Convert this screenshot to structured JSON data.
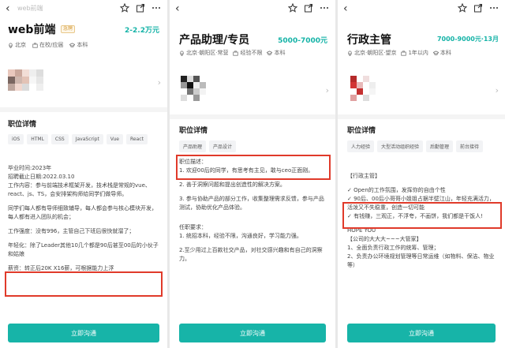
{
  "screens": [
    {
      "breadcrumb": "web前端",
      "title": "web前端",
      "badge": "急聘",
      "salary": "2-2.2万元",
      "meta": [
        "北京",
        "在校/应届",
        "本科"
      ],
      "section_title": "职位详情",
      "tags": [
        "iOS",
        "HTML",
        "CSS",
        "JavaScript",
        "Vue",
        "React"
      ],
      "desc": [
        "毕业时间:2023年",
        "招聘截止日期:2022.03.10",
        "工作内容：参与前端技术框架开发，技术栈是常规的vue、react、js、TS，会安排架构师给同学们做导师。",
        "",
        "同学们每人都有导师细致辅导，每人都会参与核心模块开发，每人都有进入团队的机会；",
        "",
        "工作强度：没有996，主管自己下班后很快就溜了；",
        "",
        "年轻化：除了Leader其他10几个都是90后甚至00后的小伙子和姑娘",
        "",
        "薪资：转正后20K X16薪，可根据能力上浮"
      ],
      "apply_label": "立即沟通"
    },
    {
      "title": "产品助理/专员",
      "salary": "5000-7000元",
      "meta": [
        "北京·朝阳区·常营",
        "经验不限",
        "本科"
      ],
      "section_title": "职位详情",
      "tags": [
        "产品助理",
        "产品设计"
      ],
      "desc": [
        "职位描述：",
        "1. 欢迎00后的同学，有思考有主见，敢与ceo正面刚。",
        "",
        "2. 善于洞察问题和提出创造性的解决方案。",
        "",
        "3. 参与协助产品的部分工作，收集整理需求反馈，参与产品测试，协助优化产品体验。",
        "",
        "",
        "任职要求：",
        "1. 统招本科，经验不限，沟通良好，学习能力强。",
        "",
        "2.至少用过上百款社交产品，对社交感兴趣和有自己的洞察力。"
      ],
      "apply_label": "立即沟通"
    },
    {
      "title": "行政主管",
      "salary": "7000-9000元·13月",
      "meta": [
        "北京·朝阳区·望京",
        "1年以内",
        "本科"
      ],
      "section_title": "职位详情",
      "tags": [
        "人力经验",
        "大型活动组织经验",
        "后勤管理",
        "前台接待"
      ],
      "desc": [
        "【行政主管】",
        "",
        "✓ Open的工作氛围，发挥你的自由个性",
        "✓ 90后、00后小哥哥小姐姐占据半壁江山，年轻充满活力，活泼又不失稳重，创造一切可能",
        "✓ 有钱赚，三观正，不浮夸，不画饼，我们都是干饭人!",
        "",
        "HOPE YOU",
        "【公司的大大大~~~大管家】",
        "1、全面负责行政工作的统筹、管理；",
        "2、负责办公环境规划管理等日常运维（如物料、保洁、物业等）"
      ],
      "apply_label": "立即沟通"
    }
  ],
  "colors": {
    "accent": "#17b4a8",
    "highlight": "#e03a2a"
  },
  "icons": [
    "back-arrow-icon",
    "star-icon",
    "share-icon",
    "more-icon",
    "location-icon",
    "briefcase-icon",
    "graduation-cap-icon",
    "chevron-right-icon"
  ]
}
